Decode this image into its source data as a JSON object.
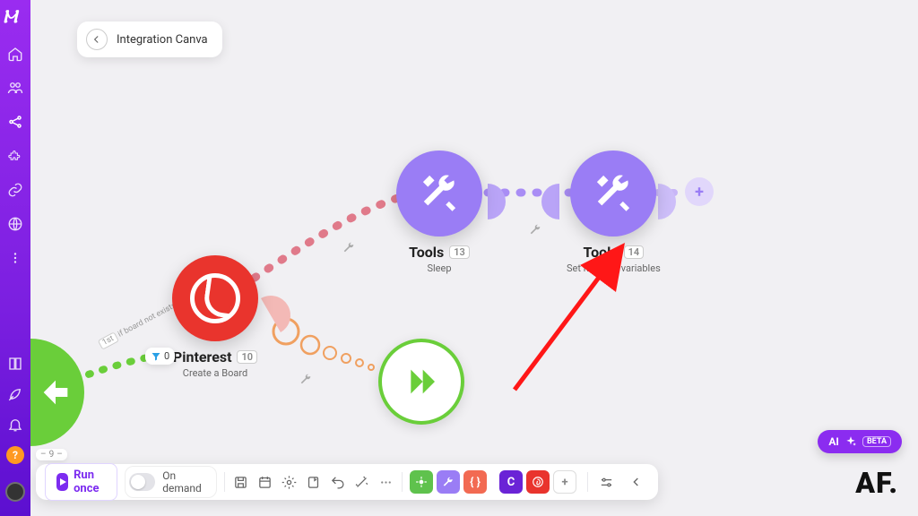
{
  "breadcrumb": {
    "title": "Integration Canva"
  },
  "nodes": {
    "pinterest": {
      "title": "Pinterest",
      "badge": "10",
      "subtitle": "Create a Board"
    },
    "tools1": {
      "title": "Tools",
      "badge": "13",
      "subtitle": "Sleep"
    },
    "tools2": {
      "title": "Tools",
      "badge": "14",
      "subtitle": "Set multiple variables"
    }
  },
  "filter": {
    "count": "0"
  },
  "path_label": {
    "order": "1st",
    "text": "if board not exists"
  },
  "step": {
    "current": "9"
  },
  "toolbar": {
    "run_label": "Run once",
    "mode_label": "On demand"
  },
  "ai": {
    "label": "AI",
    "tag": "BETA"
  },
  "watermark": "AF."
}
